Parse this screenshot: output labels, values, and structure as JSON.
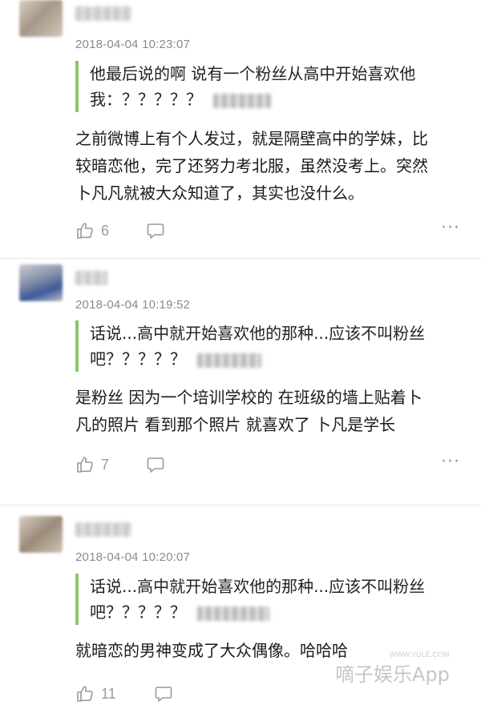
{
  "comments": [
    {
      "timestamp": "2018-04-04 10:23:07",
      "quote_lines": [
        "他最后说的啊 说有一个粉丝从高中开始喜欢他",
        "我：？？？？？"
      ],
      "reply_lines": [
        "之前微博上有个人发过，就是隔壁高中的学妹，比",
        "较暗恋他，完了还努力考北服，虽然没考上。突然",
        "卜凡凡就被大众知道了，其实也没什么。"
      ],
      "likes": "6",
      "more": "···"
    },
    {
      "timestamp": "2018-04-04 10:19:52",
      "quote_lines": [
        "话说...高中就开始喜欢他的那种...应该不叫粉丝",
        "吧？？？？？"
      ],
      "reply_lines": [
        "是粉丝 因为一个培训学校的 在班级的墙上贴着卜",
        "凡的照片 看到那个照片 就喜欢了 卜凡是学长"
      ],
      "likes": "7",
      "more": "···"
    },
    {
      "timestamp": "2018-04-04 10:20:07",
      "quote_lines": [
        "话说...高中就开始喜欢他的那种...应该不叫粉丝",
        "吧？？？？？"
      ],
      "reply_lines": [
        "就暗恋的男神变成了大众偶像。哈哈哈"
      ],
      "likes": "11",
      "more": ""
    }
  ],
  "watermark": {
    "text": "嘀子娱乐App",
    "sub": "WWW.YULE.COM"
  },
  "colors": {
    "quote_bar": "#89c66a",
    "timestamp": "#8a8a8a",
    "icon": "#9a9a9a"
  }
}
